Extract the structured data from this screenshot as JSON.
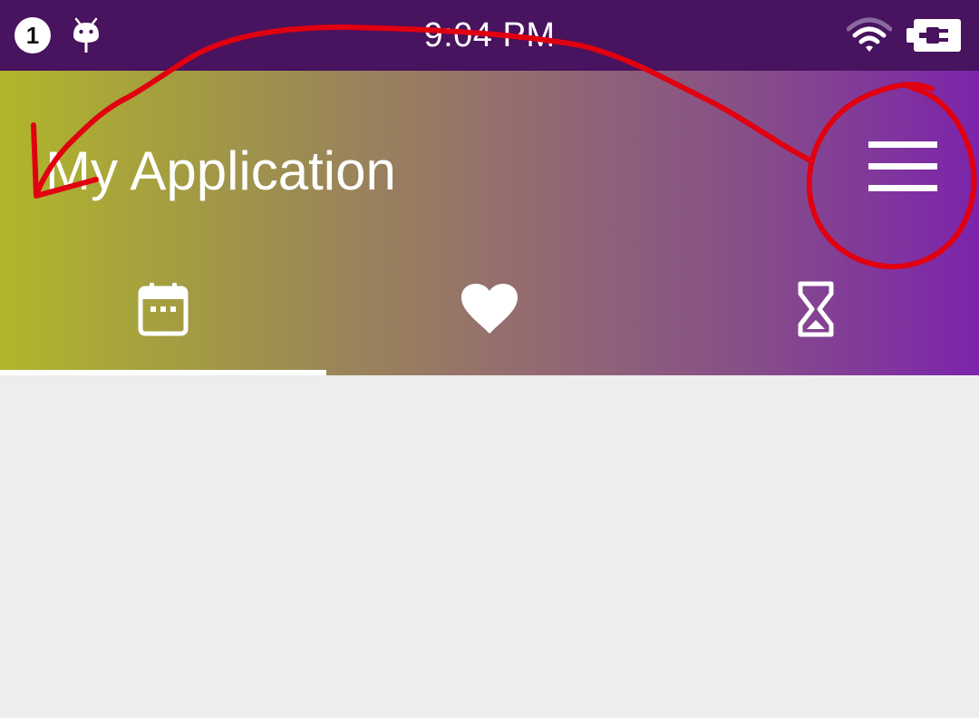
{
  "status_bar": {
    "notification_count": "1",
    "time": "9:04 PM",
    "icons": [
      "android-icon",
      "wifi-icon",
      "battery-charging-icon"
    ]
  },
  "app_bar": {
    "title": "My Application",
    "menu_icon": "hamburger-menu-icon"
  },
  "tabs": [
    {
      "icon": "calendar-icon",
      "selected": true
    },
    {
      "icon": "heart-icon",
      "selected": false
    },
    {
      "icon": "hourglass-icon",
      "selected": false
    }
  ],
  "colors": {
    "status_bar": "#48135f",
    "gradient_start": "#b0b62a",
    "gradient_end": "#7c24ab",
    "content_background": "#ededed",
    "annotation_red": "#e00010"
  },
  "annotation": {
    "type": "hand-drawn red circle around the menu icon with an arrow sweeping to the left edge"
  }
}
